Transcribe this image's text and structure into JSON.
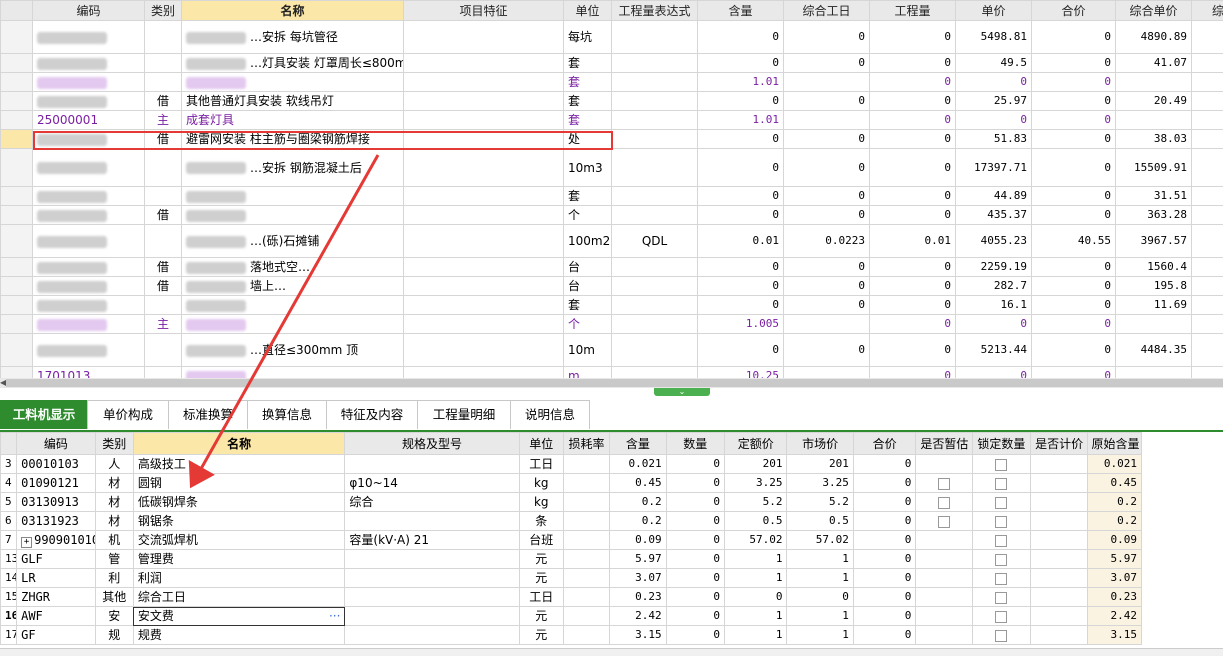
{
  "top_grid": {
    "headers": [
      "编码",
      "类别",
      "名称",
      "项目特征",
      "单位",
      "工程量表达式",
      "含量",
      "综合工日",
      "工程量",
      "单价",
      "合价",
      "综合单价",
      "综合合价"
    ],
    "rows": [
      {
        "code": "",
        "type": "",
        "name": "…安拆 每坑管径",
        "unit": "每坑",
        "expr": "",
        "qty": "0",
        "labor": "0",
        "amount": "0",
        "price": "5498.81",
        "total": "0",
        "unit_total": "4890.89",
        "sum": "",
        "style": "",
        "blur_code": true,
        "blur_name": true
      },
      {
        "code": "",
        "type": "",
        "name": "…灯具安装 灯罩周长≤800mm",
        "unit": "套",
        "expr": "",
        "qty": "0",
        "labor": "0",
        "amount": "0",
        "price": "49.5",
        "total": "0",
        "unit_total": "41.07",
        "sum": "",
        "style": "",
        "blur_code": true,
        "blur_name": true
      },
      {
        "code": "",
        "type": "",
        "name": "",
        "unit": "套",
        "expr": "",
        "qty": "1.01",
        "labor": "",
        "amount": "0",
        "price": "0",
        "total": "0",
        "unit_total": "",
        "sum": "",
        "style": "purple",
        "blur_code": true,
        "blur_name": true
      },
      {
        "code": "",
        "type": "借",
        "name": "其他普通灯具安装 软线吊灯",
        "unit": "套",
        "expr": "",
        "qty": "0",
        "labor": "0",
        "amount": "0",
        "price": "25.97",
        "total": "0",
        "unit_total": "20.49",
        "sum": "",
        "style": "",
        "blur_code": true,
        "blur_name": false
      },
      {
        "code": "25000001",
        "type": "主",
        "name": "成套灯具",
        "unit": "套",
        "expr": "",
        "qty": "1.01",
        "labor": "",
        "amount": "0",
        "price": "0",
        "total": "0",
        "unit_total": "",
        "sum": "",
        "style": "purple",
        "blur_code": false,
        "blur_name": false
      },
      {
        "code": "",
        "type": "借",
        "name": "避雷网安装 柱主筋与圈梁钢筋焊接",
        "unit": "处",
        "expr": "",
        "qty": "0",
        "labor": "0",
        "amount": "0",
        "price": "51.83",
        "total": "0",
        "unit_total": "38.03",
        "sum": "",
        "style": "sel",
        "blur_code": true,
        "blur_name": false
      },
      {
        "code": "",
        "type": "",
        "name": "…安拆 钢筋混凝土后",
        "unit": "10m3",
        "expr": "",
        "qty": "0",
        "labor": "0",
        "amount": "0",
        "price": "17397.71",
        "total": "0",
        "unit_total": "15509.91",
        "sum": "",
        "style": "",
        "blur_code": true,
        "blur_name": true
      },
      {
        "code": "",
        "type": "",
        "name": "",
        "unit": "套",
        "expr": "",
        "qty": "0",
        "labor": "0",
        "amount": "0",
        "price": "44.89",
        "total": "0",
        "unit_total": "31.51",
        "sum": "",
        "style": "",
        "blur_code": true,
        "blur_name": true
      },
      {
        "code": "",
        "type": "借",
        "name": "",
        "unit": "个",
        "expr": "",
        "qty": "0",
        "labor": "0",
        "amount": "0",
        "price": "435.37",
        "total": "0",
        "unit_total": "363.28",
        "sum": "",
        "style": "",
        "blur_code": true,
        "blur_name": true
      },
      {
        "code": "",
        "type": "",
        "name": "…(砾)石摊铺",
        "unit": "100m2",
        "expr": "QDL",
        "qty": "0.01",
        "labor": "0.0223",
        "amount": "0.01",
        "price": "4055.23",
        "total": "40.55",
        "unit_total": "3967.57",
        "sum": "39.6",
        "style": "",
        "blur_code": true,
        "blur_name": true
      },
      {
        "code": "",
        "type": "借",
        "name": "落地式空…",
        "unit": "台",
        "expr": "",
        "qty": "0",
        "labor": "0",
        "amount": "0",
        "price": "2259.19",
        "total": "0",
        "unit_total": "1560.4",
        "sum": "",
        "style": "",
        "blur_code": true,
        "blur_name": true
      },
      {
        "code": "",
        "type": "借",
        "name": "墙上…",
        "unit": "台",
        "expr": "",
        "qty": "0",
        "labor": "0",
        "amount": "0",
        "price": "282.7",
        "total": "0",
        "unit_total": "195.8",
        "sum": "",
        "style": "",
        "blur_code": true,
        "blur_name": true
      },
      {
        "code": "",
        "type": "",
        "name": "",
        "unit": "套",
        "expr": "",
        "qty": "0",
        "labor": "0",
        "amount": "0",
        "price": "16.1",
        "total": "0",
        "unit_total": "11.69",
        "sum": "",
        "style": "",
        "blur_code": true,
        "blur_name": true
      },
      {
        "code": "",
        "type": "主",
        "name": "",
        "unit": "个",
        "expr": "",
        "qty": "1.005",
        "labor": "",
        "amount": "0",
        "price": "0",
        "total": "0",
        "unit_total": "",
        "sum": "",
        "style": "purple",
        "blur_code": true,
        "blur_name": true
      },
      {
        "code": "",
        "type": "",
        "name": "…直径≤300mm 顶",
        "unit": "10m",
        "expr": "",
        "qty": "0",
        "labor": "0",
        "amount": "0",
        "price": "5213.44",
        "total": "0",
        "unit_total": "4484.35",
        "sum": "",
        "style": "",
        "blur_code": true,
        "blur_name": true
      },
      {
        "code": "1701013…",
        "type": "",
        "name": "",
        "unit": "m",
        "expr": "",
        "qty": "10.25",
        "labor": "",
        "amount": "0",
        "price": "0",
        "total": "0",
        "unit_total": "",
        "sum": "",
        "style": "purple",
        "blur_code": false,
        "blur_name": true
      }
    ]
  },
  "tabs": [
    "工料机显示",
    "单价构成",
    "标准换算",
    "换算信息",
    "特征及内容",
    "工程量明细",
    "说明信息"
  ],
  "bottom_grid": {
    "headers": [
      "",
      "编码",
      "类别",
      "名称",
      "规格及型号",
      "单位",
      "损耗率",
      "含量",
      "数量",
      "定额价",
      "市场价",
      "合价",
      "是否暂估",
      "锁定数量",
      "是否计价",
      "原始含量"
    ],
    "rows": [
      {
        "no": "3",
        "code": "00010103",
        "type": "人",
        "name": "高级技工",
        "spec": "",
        "unit": "工日",
        "loss": "",
        "qty": "0.021",
        "count": "0",
        "quota": "201",
        "market": "201",
        "total": "0",
        "est": false,
        "lock": true,
        "priced": false,
        "orig": "0.021"
      },
      {
        "no": "4",
        "code": "01090121",
        "type": "材",
        "name": "圆钢",
        "spec": "φ10~14",
        "unit": "kg",
        "loss": "",
        "qty": "0.45",
        "count": "0",
        "quota": "3.25",
        "market": "3.25",
        "total": "0",
        "est": true,
        "lock": true,
        "priced": false,
        "orig": "0.45"
      },
      {
        "no": "5",
        "code": "03130913",
        "type": "材",
        "name": "低碳钢焊条",
        "spec": "综合",
        "unit": "kg",
        "loss": "",
        "qty": "0.2",
        "count": "0",
        "quota": "5.2",
        "market": "5.2",
        "total": "0",
        "est": true,
        "lock": true,
        "priced": false,
        "orig": "0.2"
      },
      {
        "no": "6",
        "code": "03131923",
        "type": "材",
        "name": "钢锯条",
        "spec": "",
        "unit": "条",
        "loss": "",
        "qty": "0.2",
        "count": "0",
        "quota": "0.5",
        "market": "0.5",
        "total": "0",
        "est": true,
        "lock": true,
        "priced": false,
        "orig": "0.2"
      },
      {
        "no": "7",
        "code": "990901010",
        "type": "机",
        "name": "交流弧焊机",
        "spec": "容量(kV·A) 21",
        "unit": "台班",
        "loss": "",
        "qty": "0.09",
        "count": "0",
        "quota": "57.02",
        "market": "57.02",
        "total": "0",
        "est": false,
        "lock": true,
        "priced": false,
        "orig": "0.09"
      },
      {
        "no": "13",
        "code": "GLF",
        "type": "管",
        "name": "管理费",
        "spec": "",
        "unit": "元",
        "loss": "",
        "qty": "5.97",
        "count": "0",
        "quota": "1",
        "market": "1",
        "total": "0",
        "est": false,
        "lock": true,
        "priced": false,
        "orig": "5.97"
      },
      {
        "no": "14",
        "code": "LR",
        "type": "利",
        "name": "利润",
        "spec": "",
        "unit": "元",
        "loss": "",
        "qty": "3.07",
        "count": "0",
        "quota": "1",
        "market": "1",
        "total": "0",
        "est": false,
        "lock": true,
        "priced": false,
        "orig": "3.07"
      },
      {
        "no": "15",
        "code": "ZHGR",
        "type": "其他",
        "name": "综合工日",
        "spec": "",
        "unit": "工日",
        "loss": "",
        "qty": "0.23",
        "count": "0",
        "quota": "0",
        "market": "0",
        "total": "0",
        "est": false,
        "lock": true,
        "priced": false,
        "orig": "0.23"
      },
      {
        "no": "16",
        "code": "AWF",
        "type": "安",
        "name": "安文费",
        "spec": "",
        "unit": "元",
        "loss": "",
        "qty": "2.42",
        "count": "0",
        "quota": "1",
        "market": "1",
        "total": "0",
        "est": false,
        "lock": true,
        "priced": false,
        "orig": "2.42"
      },
      {
        "no": "17",
        "code": "GF",
        "type": "规",
        "name": "规费",
        "spec": "",
        "unit": "元",
        "loss": "",
        "qty": "3.15",
        "count": "0",
        "quota": "1",
        "market": "1",
        "total": "0",
        "est": false,
        "lock": true,
        "priced": false,
        "orig": "3.15"
      }
    ]
  },
  "colors": {
    "highlight_header": "#fbe7a8",
    "active_tab": "#2e8b2e",
    "annotation": "#e53935",
    "purple_text": "#7a1fa2"
  }
}
